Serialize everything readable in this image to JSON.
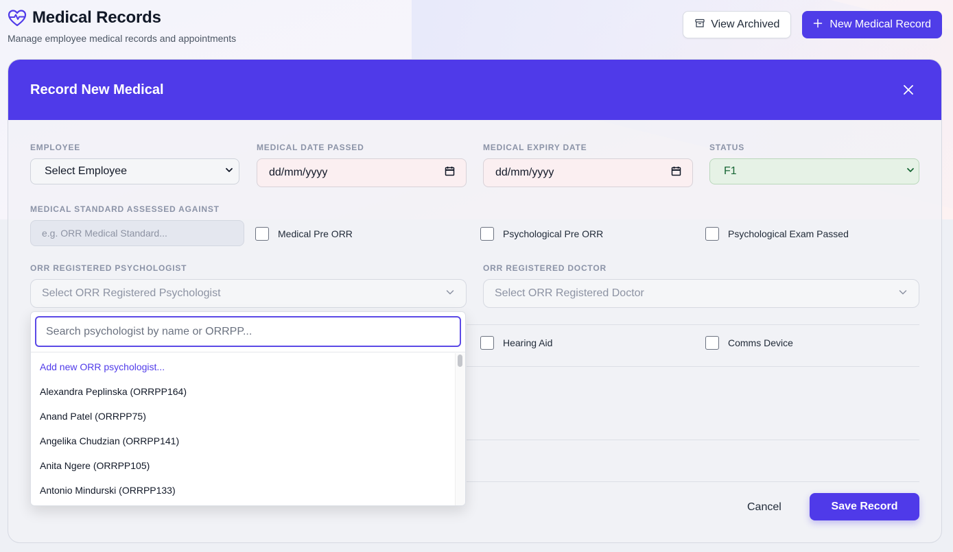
{
  "header": {
    "title": "Medical Records",
    "subtitle": "Manage employee medical records and appointments",
    "view_archived_label": "View Archived",
    "new_record_label": "New Medical Record"
  },
  "modal": {
    "title": "Record New Medical",
    "fields": {
      "employee_label": "Employee",
      "employee_value": "Select Employee",
      "date_passed_label": "Medical Date Passed",
      "date_passed_value": "dd/mm/yyyy",
      "expiry_label": "Medical Expiry Date",
      "expiry_value": "dd/mm/yyyy",
      "status_label": "Status",
      "status_value": "F1",
      "standard_label": "Medical Standard Assessed Against",
      "standard_placeholder": "e.g. ORR Medical Standard...",
      "psychologist_label": "ORR Registered Psychologist",
      "psychologist_placeholder": "Select ORR Registered Psychologist",
      "doctor_label": "ORR Registered Doctor",
      "doctor_placeholder": "Select ORR Registered Doctor"
    },
    "checkboxes": {
      "medical_pre_orr": "Medical Pre ORR",
      "psychological_pre_orr": "Psychological Pre ORR",
      "psychological_exam_passed": "Psychological Exam Passed",
      "hearing_aid": "Hearing Aid",
      "comms_device": "Comms Device"
    },
    "cancel_label": "Cancel",
    "save_label": "Save Record"
  },
  "dropdown": {
    "search_placeholder": "Search psychologist by name or ORRPP...",
    "items": [
      "Add new ORR psychologist...",
      "Alexandra Peplinska (ORRPP164)",
      "Anand Patel (ORRPP75)",
      "Angelika Chudzian (ORRPP141)",
      "Anita Ngere (ORRPP105)",
      "Antonio Mindurski (ORRPP133)"
    ]
  },
  "colors": {
    "accent": "#4f3ae9",
    "status_bg": "#e6f2e6"
  }
}
